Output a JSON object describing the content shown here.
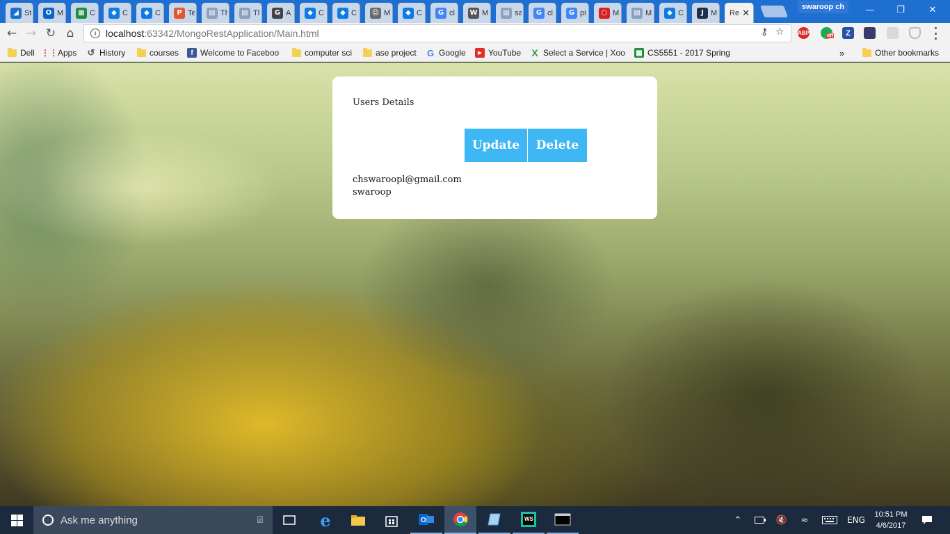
{
  "browser": {
    "tabs": [
      {
        "title": "St",
        "favicon": "bluearrow"
      },
      {
        "title": "M",
        "favicon": "outlook"
      },
      {
        "title": "C",
        "favicon": "sheets"
      },
      {
        "title": "C",
        "favicon": "dropbox"
      },
      {
        "title": "C",
        "favicon": "dropbox"
      },
      {
        "title": "Te",
        "favicon": "p-logo"
      },
      {
        "title": "Th",
        "favicon": "doc"
      },
      {
        "title": "Tl",
        "favicon": "doc"
      },
      {
        "title": "A",
        "favicon": "github"
      },
      {
        "title": "C",
        "favicon": "dropbox"
      },
      {
        "title": "C",
        "favicon": "dropbox"
      },
      {
        "title": "M",
        "favicon": "avatar"
      },
      {
        "title": "C",
        "favicon": "dropbox"
      },
      {
        "title": "cl",
        "favicon": "google"
      },
      {
        "title": "M",
        "favicon": "wikipedia"
      },
      {
        "title": "sa",
        "favicon": "doc"
      },
      {
        "title": "cl",
        "favicon": "google"
      },
      {
        "title": "pi",
        "favicon": "google"
      },
      {
        "title": "M",
        "favicon": "oracle"
      },
      {
        "title": "M",
        "favicon": "doc"
      },
      {
        "title": "C",
        "favicon": "dropbox"
      },
      {
        "title": "M",
        "favicon": "j-logo"
      },
      {
        "title": "Re",
        "favicon": "none",
        "active": true
      }
    ],
    "profile_name": "swaroop ch",
    "address": {
      "host": "localhost",
      "rest": ":63342/MongoRestApplication/Main.html"
    },
    "extensions": [
      "ABP",
      "off",
      "Z"
    ],
    "bookmarks": [
      {
        "label": "Dell",
        "icon": "folder"
      },
      {
        "label": "Apps",
        "icon": "apps-grid"
      },
      {
        "label": "History",
        "icon": "history"
      },
      {
        "label": "courses",
        "icon": "folder"
      },
      {
        "label": "Welcome to Faceboo",
        "icon": "facebook"
      },
      {
        "label": "computer sci",
        "icon": "folder"
      },
      {
        "label": "ase project",
        "icon": "folder"
      },
      {
        "label": "Google",
        "icon": "google"
      },
      {
        "label": "YouTube",
        "icon": "youtube"
      },
      {
        "label": "Select a Service | Xoo",
        "icon": "xoom"
      },
      {
        "label": "CS5551 - 2017 Spring",
        "icon": "sheets"
      }
    ],
    "bookmarks_overflow": "»",
    "other_bookmarks": "Other bookmarks"
  },
  "page": {
    "card_title": "Users Details",
    "update_label": "Update",
    "delete_label": "Delete",
    "user": {
      "email": "chswaroopl@gmail.com",
      "name": "swaroop"
    },
    "button_color": "#3fb7f5"
  },
  "taskbar": {
    "search_placeholder": "Ask me anything",
    "language": "ENG",
    "time": "10:51 PM",
    "date": "4/6/2017"
  }
}
